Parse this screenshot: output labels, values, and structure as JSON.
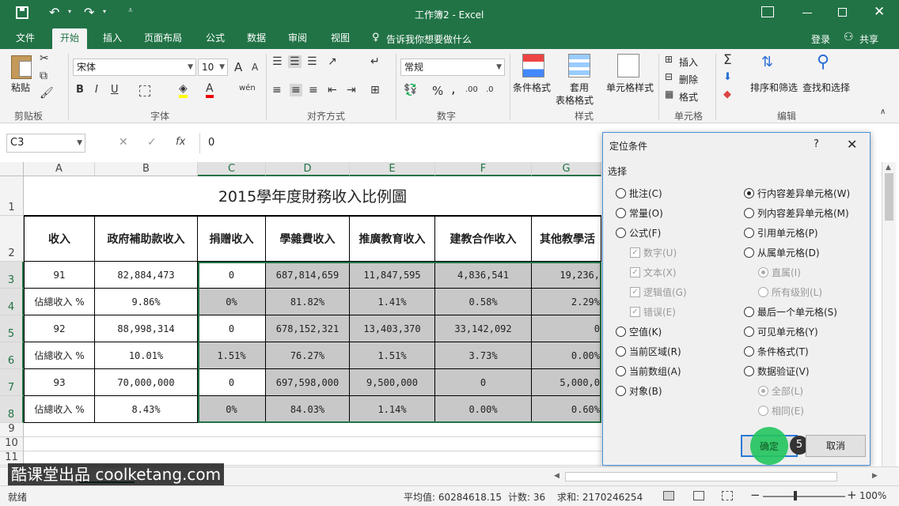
{
  "window": {
    "title": "工作簿2 - Excel"
  },
  "tabs": [
    "文件",
    "开始",
    "插入",
    "页面布局",
    "公式",
    "数据",
    "审阅",
    "视图"
  ],
  "tell_me": "告诉我你想要做什么",
  "account": {
    "login": "登录",
    "share": "共享"
  },
  "ribbon": {
    "clipboard": {
      "paste": "粘贴",
      "label": "剪贴板"
    },
    "font": {
      "name": "宋体",
      "size": "10",
      "label": "字体",
      "bold": "B",
      "italic": "I",
      "underline": "U",
      "grow": "A",
      "shrink": "A",
      "phonetic": "wén"
    },
    "alignment": {
      "label": "对齐方式"
    },
    "number": {
      "format": "常规",
      "label": "数字",
      "percent": "%",
      "comma": ","
    },
    "styles": {
      "conditional": "条件格式",
      "table": "套用",
      "table2": "表格格式",
      "cell": "单元格样式",
      "label": "样式"
    },
    "cells": {
      "insert": "插入",
      "delete": "删除",
      "format": "格式",
      "label": "单元格"
    },
    "editing": {
      "sort": "排序和筛选",
      "find": "查找和选择",
      "label": "编辑"
    }
  },
  "formula_bar": {
    "name_box": "C3",
    "fx": "fx",
    "value": "0"
  },
  "columns": [
    "A",
    "B",
    "C",
    "D",
    "E",
    "F",
    "G"
  ],
  "rows": [
    "1",
    "2",
    "3",
    "4",
    "5",
    "6",
    "7",
    "8",
    "9",
    "10",
    "11"
  ],
  "sheet": {
    "title": "2015學年度財務收入比例圖",
    "headers": [
      "收入",
      "政府補助款收入",
      "捐贈收入",
      "學雜費收入",
      "推廣教育收入",
      "建教合作收入",
      "其他教學活"
    ],
    "data": [
      [
        "91",
        "82,884,473",
        "0",
        "687,814,659",
        "11,847,595",
        "4,836,541",
        "19,236,"
      ],
      [
        "佔總收入 %",
        "9.86%",
        "0%",
        "81.82%",
        "1.41%",
        "0.58%",
        "2.29%"
      ],
      [
        "92",
        "88,998,314",
        "0",
        "678,152,321",
        "13,403,370",
        "33,142,092",
        "0"
      ],
      [
        "佔總收入 %",
        "10.01%",
        "1.51%",
        "76.27%",
        "1.51%",
        "3.73%",
        "0.00%"
      ],
      [
        "93",
        "70,000,000",
        "0",
        "697,598,000",
        "9,500,000",
        "0",
        "5,000,0"
      ],
      [
        "佔總收入 %",
        "8.43%",
        "0%",
        "84.03%",
        "1.14%",
        "0.00%",
        "0.60%"
      ]
    ]
  },
  "dialog": {
    "title": "定位条件",
    "help": "?",
    "section": "选择",
    "left": [
      {
        "label": "批注(C)",
        "type": "radio",
        "on": false,
        "dis": false
      },
      {
        "label": "常量(O)",
        "type": "radio",
        "on": false,
        "dis": false
      },
      {
        "label": "公式(F)",
        "type": "radio",
        "on": false,
        "dis": false
      },
      {
        "label": "数字(U)",
        "type": "chk",
        "on": true,
        "dis": true
      },
      {
        "label": "文本(X)",
        "type": "chk",
        "on": true,
        "dis": true
      },
      {
        "label": "逻辑值(G)",
        "type": "chk",
        "on": true,
        "dis": true
      },
      {
        "label": "错误(E)",
        "type": "chk",
        "on": true,
        "dis": true
      },
      {
        "label": "空值(K)",
        "type": "radio",
        "on": false,
        "dis": false
      },
      {
        "label": "当前区域(R)",
        "type": "radio",
        "on": false,
        "dis": false
      },
      {
        "label": "当前数组(A)",
        "type": "radio",
        "on": false,
        "dis": false
      },
      {
        "label": "对象(B)",
        "type": "radio",
        "on": false,
        "dis": false
      }
    ],
    "right": [
      {
        "label": "行内容差异单元格(W)",
        "type": "radio",
        "on": true,
        "dis": false
      },
      {
        "label": "列内容差异单元格(M)",
        "type": "radio",
        "on": false,
        "dis": false
      },
      {
        "label": "引用单元格(P)",
        "type": "radio",
        "on": false,
        "dis": false
      },
      {
        "label": "从属单元格(D)",
        "type": "radio",
        "on": false,
        "dis": false
      },
      {
        "label": "直属(I)",
        "type": "radio",
        "on": true,
        "dis": true
      },
      {
        "label": "所有级别(L)",
        "type": "radio",
        "on": false,
        "dis": true
      },
      {
        "label": "最后一个单元格(S)",
        "type": "radio",
        "on": false,
        "dis": false
      },
      {
        "label": "可见单元格(Y)",
        "type": "radio",
        "on": false,
        "dis": false
      },
      {
        "label": "条件格式(T)",
        "type": "radio",
        "on": false,
        "dis": false
      },
      {
        "label": "数据验证(V)",
        "type": "radio",
        "on": false,
        "dis": false
      },
      {
        "label": "全部(L)",
        "type": "radio",
        "on": true,
        "dis": true
      },
      {
        "label": "相同(E)",
        "type": "radio",
        "on": false,
        "dis": true
      }
    ],
    "ok": "确定",
    "cancel": "取消",
    "step_badge": "5"
  },
  "watermark": "酷课堂出品 coolketang.com",
  "status": {
    "ready": "就绪",
    "average": "平均值: 60284618.15",
    "count": "计数: 36",
    "sum": "求和: 2170246254",
    "zoom": "100%"
  },
  "colors": {
    "excel_green": "#217346",
    "selected_gray": "#c8c8c8",
    "click_green": "#22c55e"
  }
}
